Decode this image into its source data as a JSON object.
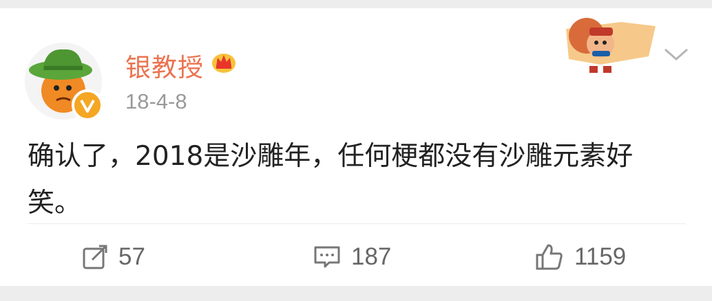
{
  "post": {
    "author": "银教授",
    "timestamp": "18-4-8",
    "text": "确认了，2018是沙雕年，任何梗都没有沙雕元素好笑。",
    "icons": {
      "avatar": "cartoon-orange-with-green-hat",
      "verified": "v-badge-icon",
      "member": "crown-icon",
      "decoration": "cartoon-character-sticker",
      "menu": "chevron-down-icon"
    }
  },
  "actions": {
    "repost_count": "57",
    "comment_count": "187",
    "like_count": "1159"
  },
  "colors": {
    "username": "#eb7350",
    "badge": "#f5a623",
    "text": "#222222",
    "muted": "#999999"
  }
}
